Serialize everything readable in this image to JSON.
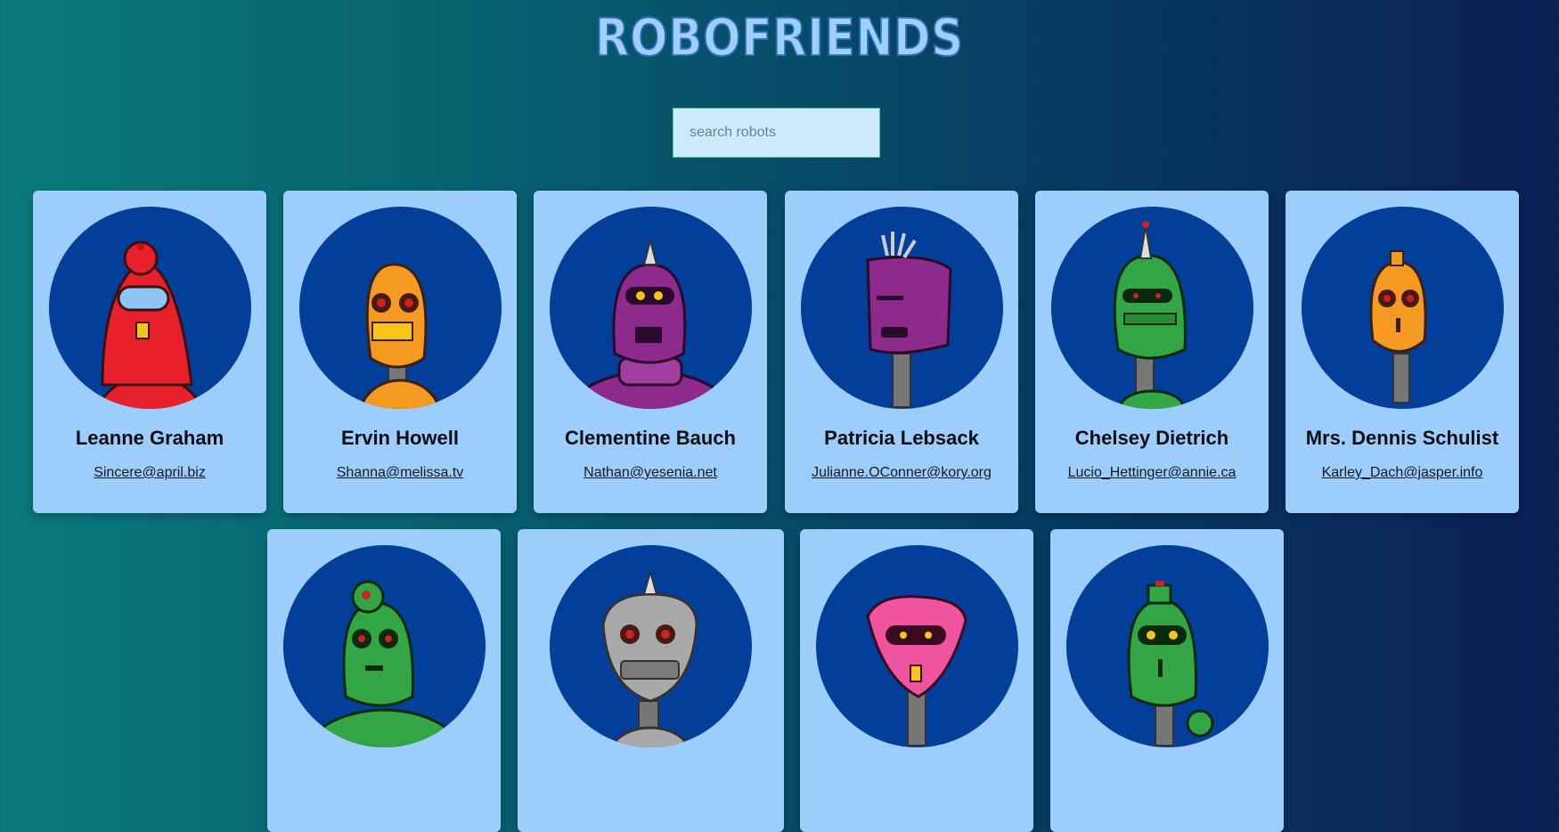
{
  "header": {
    "title": "ROBOFRIENDS"
  },
  "search": {
    "placeholder": "search robots",
    "value": ""
  },
  "colors": {
    "title_fill": "#9ed0fb",
    "title_stroke": "#2a6bbd",
    "card_bg": "#9dcdfb",
    "avatar_bg": "#023f9b"
  },
  "robots": [
    {
      "name": "Leanne Graham",
      "email": "Sincere@april.biz",
      "color": "#e8202b"
    },
    {
      "name": "Ervin Howell",
      "email": "Shanna@melissa.tv",
      "color": "#f49a22"
    },
    {
      "name": "Clementine Bauch",
      "email": "Nathan@yesenia.net",
      "color": "#8e2a8c"
    },
    {
      "name": "Patricia Lebsack",
      "email": "Julianne.OConner@kory.org",
      "color": "#8e2a8c"
    },
    {
      "name": "Chelsey Dietrich",
      "email": "Lucio_Hettinger@annie.ca",
      "color": "#33a544"
    },
    {
      "name": "Mrs. Dennis Schulist",
      "email": "Karley_Dach@jasper.info",
      "color": "#f49a22"
    },
    {
      "name": "",
      "email": "",
      "color": "#33a544"
    },
    {
      "name": "",
      "email": "",
      "color": "#a9a9a9"
    },
    {
      "name": "",
      "email": "",
      "color": "#f0549f"
    },
    {
      "name": "",
      "email": "",
      "color": "#33a544"
    }
  ]
}
